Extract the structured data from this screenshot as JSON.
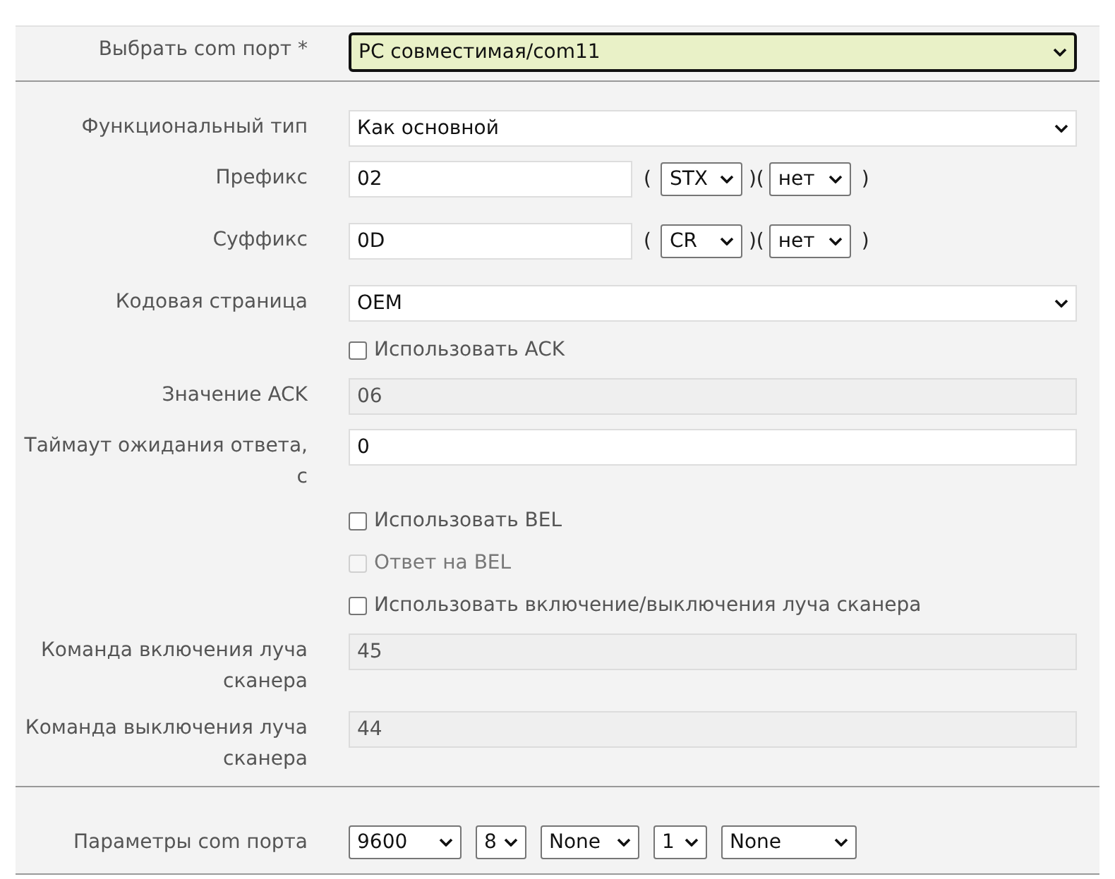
{
  "sections": [
    {
      "rows": [
        {
          "kind": "select",
          "label": "Выбрать com порт *",
          "value": "PC совместимая/com11",
          "focused": true
        }
      ]
    },
    {
      "rows": [
        {
          "kind": "select",
          "label": "Функциональный тип",
          "value": "Как основной",
          "focused": false
        },
        {
          "kind": "code",
          "label": "Префикс",
          "value": "02",
          "open": "(",
          "middle": ")(",
          "close": ")",
          "selects": [
            "STX",
            "нет"
          ]
        },
        {
          "kind": "code",
          "label": "Суффикс",
          "value": "0D",
          "open": "(",
          "middle": ")(",
          "close": ")",
          "selects": [
            "CR",
            "нет"
          ]
        },
        {
          "kind": "select",
          "label": "Кодовая страница",
          "value": "OEM",
          "focused": false
        },
        {
          "kind": "checkbox",
          "label": "Использовать ACK",
          "checked": false,
          "disabled": false
        },
        {
          "kind": "input",
          "label": "Значение ACK",
          "value": "06",
          "disabled": true
        },
        {
          "kind": "input",
          "label": "Таймаут ожидания ответа, с",
          "value": "0",
          "disabled": false
        },
        {
          "kind": "checkbox",
          "label": "Использовать BEL",
          "checked": false,
          "disabled": false
        },
        {
          "kind": "checkbox",
          "label": "Ответ на BEL",
          "checked": false,
          "disabled": true
        },
        {
          "kind": "checkbox",
          "label": "Использовать включение/выключения луча сканера",
          "checked": false,
          "disabled": false
        },
        {
          "kind": "input",
          "label": "Команда включения луча сканера",
          "value": "45",
          "disabled": true
        },
        {
          "kind": "input",
          "label": "Команда выключения луча сканера",
          "value": "44",
          "disabled": true
        }
      ]
    },
    {
      "rows": [
        {
          "kind": "selects",
          "label": "Параметры com порта",
          "selects": [
            "9600",
            "8",
            "None",
            "1",
            "None"
          ]
        }
      ]
    }
  ]
}
